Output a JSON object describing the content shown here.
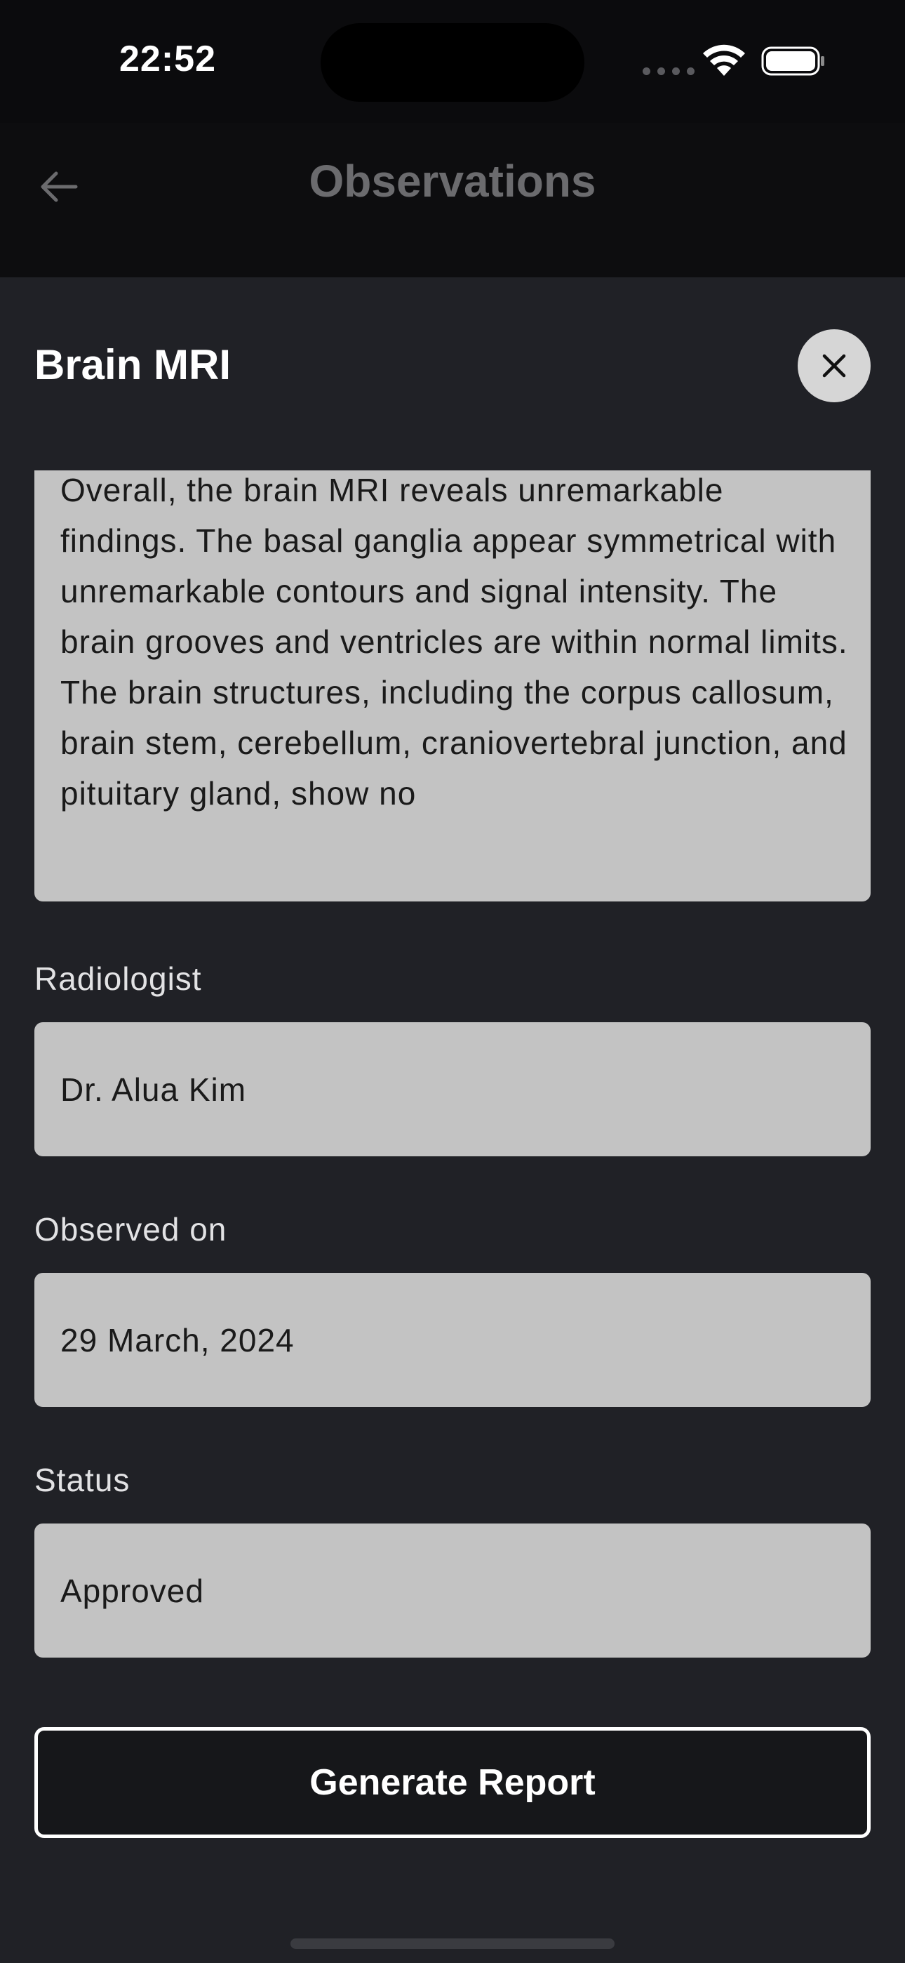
{
  "status_bar": {
    "time": "22:52"
  },
  "nav": {
    "title": "Observations",
    "back_icon": "arrow-left-icon"
  },
  "sheet": {
    "title": "Brain MRI",
    "close_icon": "close-icon",
    "findings": "Overall, the brain MRI reveals unremarkable findings. The basal ganglia appear symmetrical with unremarkable contours and signal intensity. The brain grooves and ventricles are within normal limits. The brain structures, including the corpus callosum, brain stem, cerebellum, craniovertebral junction, and pituitary gland, show no",
    "fields": {
      "radiologist": {
        "label": "Radiologist",
        "value": "Dr. Alua Kim"
      },
      "observed_on": {
        "label": "Observed on",
        "value": "29 March, 2024"
      },
      "status": {
        "label": "Status",
        "value": "Approved"
      }
    },
    "generate_button_label": "Generate Report"
  },
  "colors": {
    "background": "#0b0b0d",
    "sheet": "#202126",
    "field": "#c3c3c3",
    "button_border": "#ffffff"
  }
}
